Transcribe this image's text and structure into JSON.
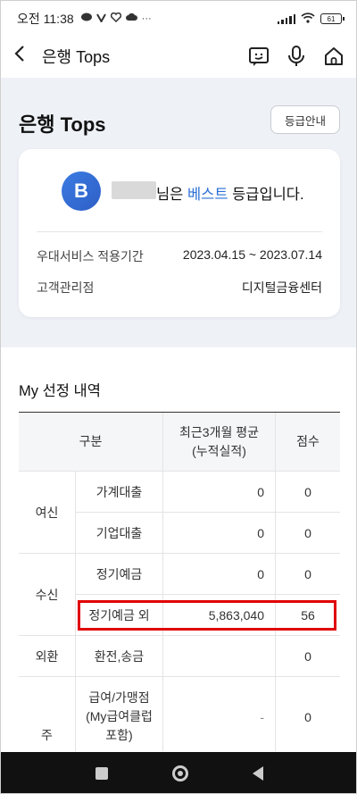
{
  "status_bar": {
    "time": "오전 11:38",
    "icons": [
      "chat-bubble-icon",
      "v-app-icon",
      "heart-icon",
      "cloud-icon",
      "more-dots-icon"
    ],
    "battery": "61"
  },
  "header": {
    "back_icon": "chevron-left-icon",
    "title": "은행 Tops",
    "actions": [
      "chat-icon",
      "microphone-icon",
      "home-icon"
    ]
  },
  "page": {
    "title": "은행 Tops",
    "guide_button": "등급안내"
  },
  "card": {
    "badge_letter": "B",
    "message_prefix": "님은 ",
    "grade": "베스트",
    "message_suffix": " 등급입니다.",
    "period_label": "우대서비스 적용기간",
    "period_value": "2023.04.15 ~ 2023.07.14",
    "branch_label": "고객관리점",
    "branch_value": "디지털금융센터"
  },
  "selection": {
    "title": "My 선정 내역",
    "headers": {
      "category": "구분",
      "avg": "최근3개월 평균\n(누적실적)",
      "score": "점수"
    },
    "rows": [
      {
        "group": "여신",
        "item": "가계대출",
        "value": "0",
        "score": "0"
      },
      {
        "group": "",
        "item": "기업대출",
        "value": "0",
        "score": "0"
      },
      {
        "group": "수신",
        "item": "정기예금",
        "value": "0",
        "score": "0"
      },
      {
        "group": "",
        "item": "정기예금 외",
        "value": "5,863,040",
        "score": "56"
      },
      {
        "group": "외환",
        "item": "환전,송금",
        "value": "",
        "score": "0"
      },
      {
        "group": "주",
        "item": "급여/가맹점\n(My급여클럽\n포함)",
        "value": "-",
        "score": "0"
      }
    ]
  },
  "colors": {
    "accent": "#2a6fd6",
    "highlight": "#e00000",
    "section_bg": "#eef2f7"
  }
}
